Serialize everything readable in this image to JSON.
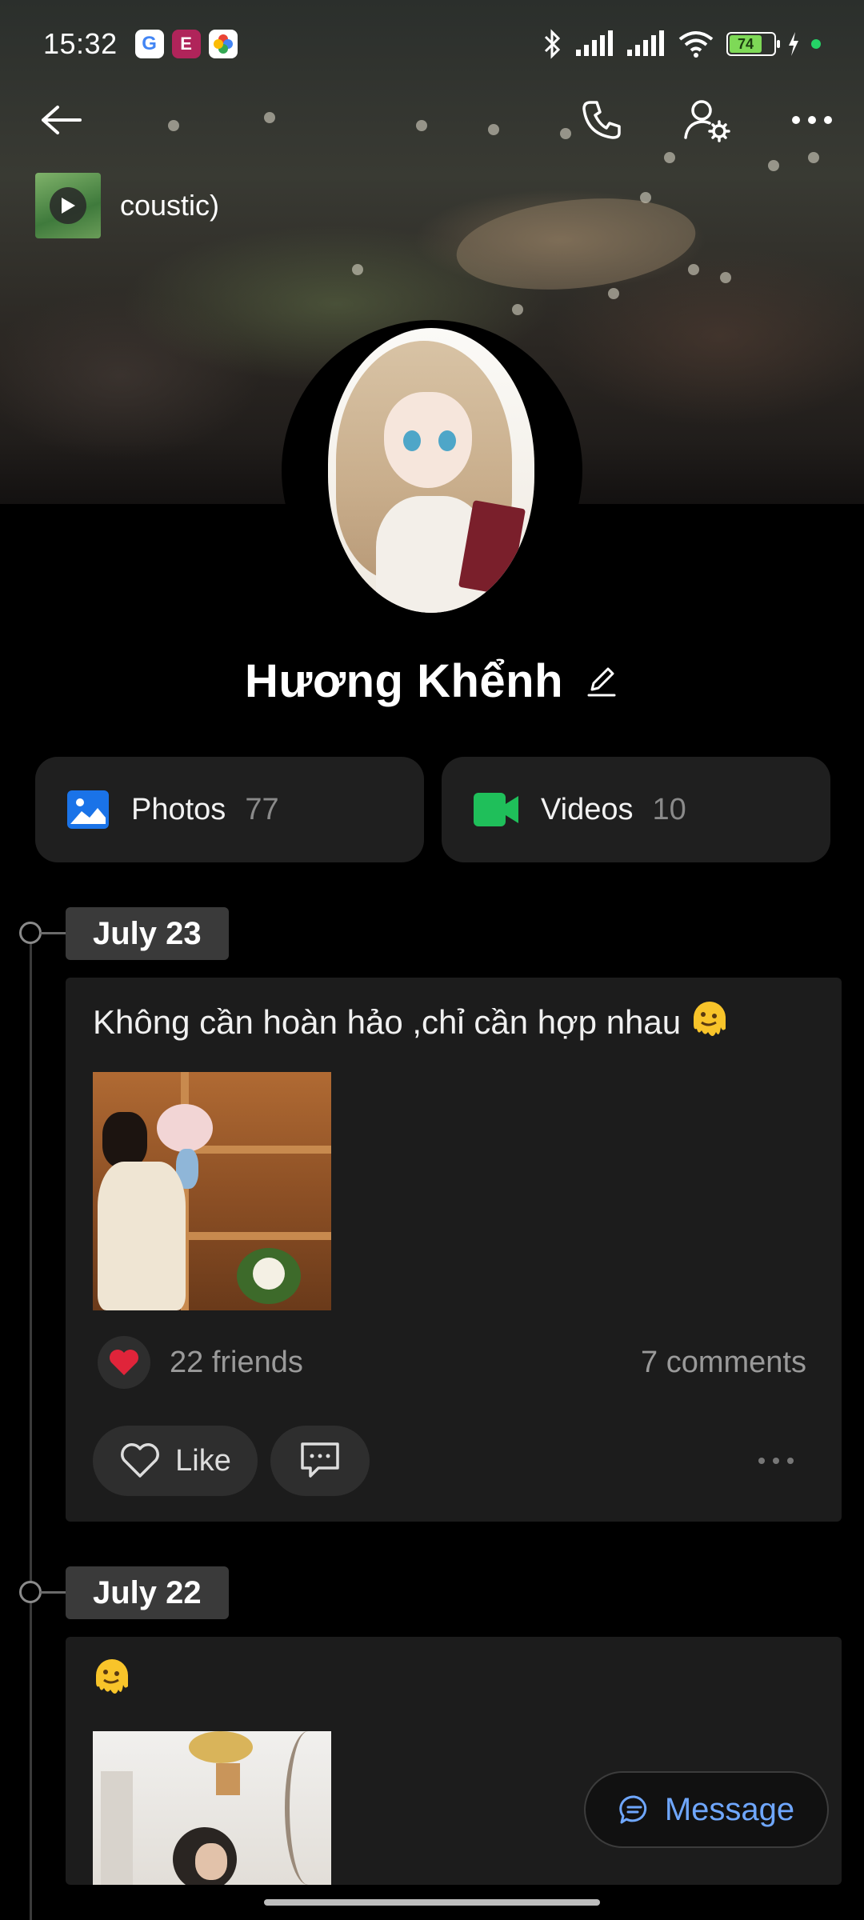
{
  "status_bar": {
    "time": "15:32",
    "app_icons": [
      "google-icon",
      "e-app-icon",
      "photos-pinwheel-icon"
    ],
    "battery_level": "74",
    "indicators": [
      "bluetooth-icon",
      "signal-icon",
      "signal-icon",
      "wifi-icon",
      "battery-icon",
      "charging-icon"
    ]
  },
  "header": {
    "music_title": "coustic)",
    "icons": {
      "back": "arrow-left-icon",
      "call": "phone-icon",
      "settings": "user-settings-icon",
      "more": "more-horizontal-icon"
    }
  },
  "profile": {
    "name": "Hương Khểnh"
  },
  "media": {
    "photos_label": "Photos",
    "photos_count": "77",
    "videos_label": "Videos",
    "videos_count": "10"
  },
  "posts": [
    {
      "date": "July 23",
      "text": "Không cần hoàn hảo ,chỉ cần hợp nhau",
      "reactions": "22 friends",
      "comments": "7 comments",
      "like_label": "Like"
    },
    {
      "date": "July 22",
      "text": ""
    }
  ],
  "actions": {
    "message_label": "Message"
  },
  "colors": {
    "photos_icon": "#1a73e8",
    "videos_icon": "#1fbf5a",
    "message_text": "#6fa7ff",
    "battery_fill": "#7ed957",
    "heart": "#e0243a"
  }
}
